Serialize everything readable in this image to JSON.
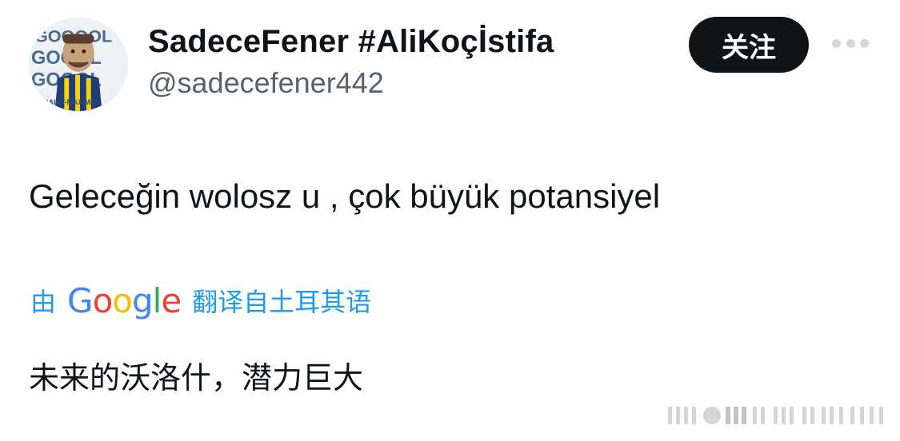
{
  "author": {
    "display_name": "SadeceFener #AliKoçİstifa",
    "handle": "@sadecefener442",
    "avatar_text": {
      "line1": "GOOOOL",
      "line2": "GOOOL",
      "line3": "GOOOL",
      "caption": "SAINT-MAXIMIN"
    }
  },
  "actions": {
    "follow_label": "关注",
    "more_icon": "more-horizontal-icon"
  },
  "tweet": {
    "text": "Geleceğin wolosz u , çok büyük potansiyel"
  },
  "translation": {
    "by_label": "由",
    "service_name": "Google",
    "from_label": "翻译自土耳其语",
    "text": "未来的沃洛什，潜力巨大"
  },
  "colors": {
    "primary_text": "#0f1419",
    "secondary_text": "#536471",
    "link_blue": "#1d9bf0",
    "button_bg": "#0f1419"
  }
}
